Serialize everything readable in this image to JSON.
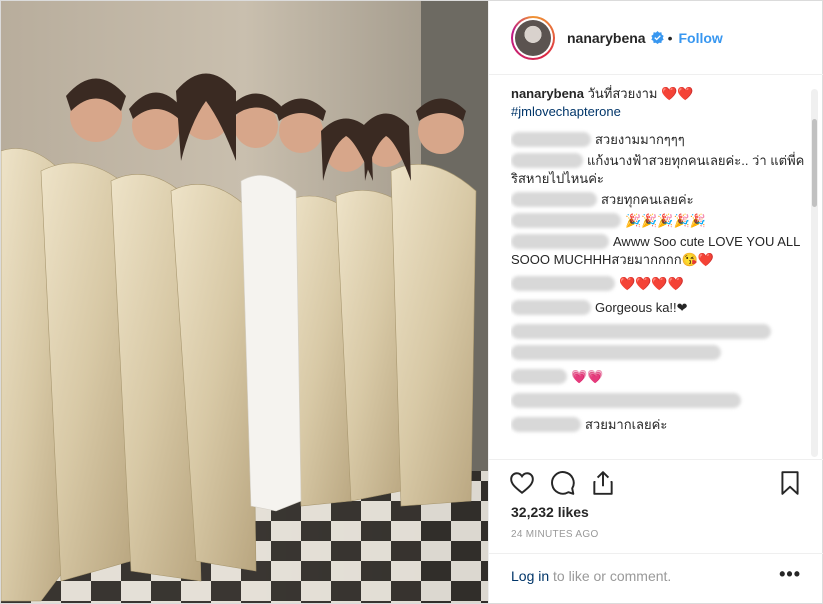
{
  "header": {
    "username": "nanarybena",
    "follow_label": "Follow"
  },
  "caption": {
    "username": "nanarybena",
    "text": "วันที่สวยงาม",
    "emoji": "❤️❤️",
    "hashtag": "#jmlovechapterone"
  },
  "comments": [
    {
      "text": "สวยงามมากๆๆๆ"
    },
    {
      "text": "แก้งนางฟ้าสวยทุกคนเลยค่ะ.. ว่า แต่พี่คริสหายไปไหนค่ะ"
    },
    {
      "text": "สวยทุกคนเลยค่ะ"
    },
    {
      "text": "🎉🎉🎉🎉🎉"
    },
    {
      "text": "Awww Soo cute LOVE YOU ALL SOOO MUCHHHสวยมากกกก😘❤️"
    },
    {
      "text": "❤️❤️❤️❤️"
    },
    {
      "text": "Gorgeous ka!!❤"
    },
    {
      "text": ""
    },
    {
      "text": ""
    },
    {
      "text": "💗💗"
    },
    {
      "text": ""
    },
    {
      "text": "สวยมากเลยค่ะ"
    }
  ],
  "likes": "32,232 likes",
  "timestamp": "24 MINUTES AGO",
  "footer": {
    "login_label": "Log in",
    "login_rest": "to like or comment.",
    "more_label": "•••"
  },
  "colors": {
    "link_blue": "#3897f0",
    "hashtag_navy": "#003569",
    "text": "#262626",
    "muted": "#999999",
    "heart_red": "#ed4956"
  },
  "icons": [
    "heart-icon",
    "comment-icon",
    "share-icon",
    "bookmark-icon",
    "verified-badge-icon"
  ]
}
